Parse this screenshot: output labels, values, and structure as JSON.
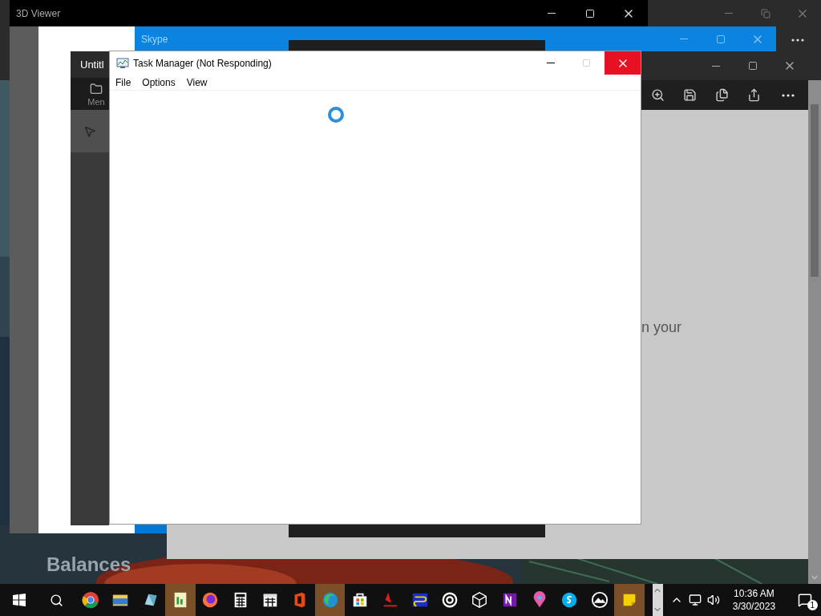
{
  "desktop": {
    "caption": "Balances"
  },
  "viewer_3d": {
    "title": "3D Viewer"
  },
  "skype": {
    "title": "Skype"
  },
  "paint": {
    "title": "Untitl",
    "toolbar_label": "Men"
  },
  "photos": {
    "body_text": "n your"
  },
  "task_manager": {
    "title": "Task Manager (Not Responding)",
    "menu": [
      "File",
      "Options",
      "View"
    ],
    "maximize_disabled": true,
    "close_hovered": true,
    "loading": true
  },
  "taskbar": {
    "apps": [
      {
        "active": false
      },
      {
        "active": false
      },
      {
        "active": false
      },
      {
        "active": true
      },
      {
        "active": false
      },
      {
        "active": false
      },
      {
        "active": false
      },
      {
        "active": false
      },
      {
        "active": true
      },
      {
        "active": false
      },
      {
        "active": false
      },
      {
        "active": false
      },
      {
        "active": false
      },
      {
        "active": false
      },
      {
        "active": false
      },
      {
        "active": false
      },
      {
        "active": false
      },
      {
        "active": false
      },
      {
        "active": true
      }
    ],
    "clock": {
      "time": "10:36 AM",
      "date": "3/30/2023"
    },
    "notifications": {
      "count": "1"
    }
  }
}
